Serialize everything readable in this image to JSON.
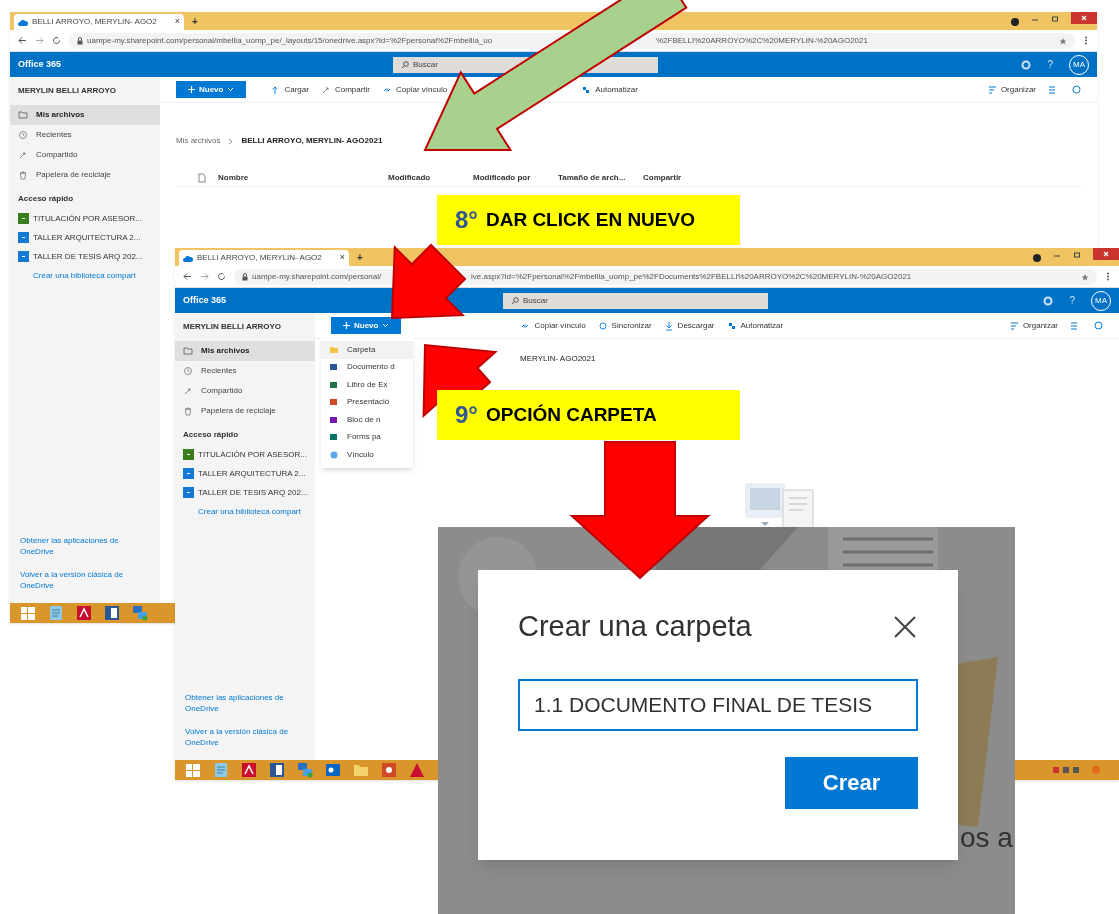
{
  "windows": [
    {
      "tab_title": "BELLI ARROYO, MERYLIN- AGO2",
      "tab_close": "×",
      "new_tab": "+",
      "url_start": "uampe-my.sharepoint.com/personal/mbellia_uomp_pe/_layouts/15/onedrive.aspx?id=%2Fpersonal%2Fmbellia_uo",
      "url_end": "%2FBELLI%20ARROYO%2C%20MERYLIN-%20AGO2021",
      "app_name": "Office 365",
      "search_placeholder": "Buscar",
      "help": "?",
      "avatar": "MA",
      "user_name": "MERYLIN BELLI ARROYO",
      "nav": [
        {
          "label": "Mis archivos",
          "kind": "folder",
          "selected": true
        },
        {
          "label": "Recientes",
          "kind": "clock",
          "selected": false
        },
        {
          "label": "Compartido",
          "kind": "share",
          "selected": false
        },
        {
          "label": "Papelera de reciclaje",
          "kind": "trash",
          "selected": false
        }
      ],
      "quick_heading": "Acceso rápido",
      "quick": [
        {
          "label": "TITULACIÓN POR ASESOR...",
          "color": "#3a7d1e"
        },
        {
          "label": "TALLER ARQUITECTURA 2...",
          "color": "#1479d4"
        },
        {
          "label": "TALLER DE TESIS ARQ 202...",
          "color": "#1479d4"
        }
      ],
      "create_library": "Crear una biblioteca compart",
      "footer_links": [
        "Obtener las aplicaciones de OneDrive",
        "Volver a la versión clásica de OneDrive"
      ],
      "new_button": "Nuevo",
      "toolbar_groups": [
        [
          {
            "label": "Cargar",
            "kind": "upload"
          },
          {
            "label": "Compartir",
            "kind": "share"
          },
          {
            "label": "Copiar vínculo",
            "kind": "link"
          }
        ],
        [
          {
            "label": "Automatizar",
            "kind": "automate"
          }
        ]
      ],
      "organize": "Organizar",
      "breadcrumb": [
        "Mis archivos",
        "BELLI ARROYO, MERYLIN- AGO2021"
      ],
      "columns": [
        "Nombre",
        "Modificado",
        "Modificado por",
        "Tamaño de arch...",
        "Compartir"
      ]
    },
    {
      "tab_title": "BELLI ARROYO, MERYLIN- AGO2",
      "tab_close": "×",
      "new_tab": "+",
      "url_start": "uampe-my.sharepoint.com/personal/",
      "url_end": "ive.aspx?id=%2Fpersonal%2Fmbellia_uomp_pe%2FDocuments%2FBELLI%20ARROYO%2C%20MERYLIN-%20AGO2021",
      "app_name": "Office 365",
      "search_placeholder": "Buscar",
      "help": "?",
      "avatar": "MA",
      "user_name": "MERYLIN BELLI ARROYO",
      "nav": [
        {
          "label": "Mis archivos",
          "kind": "folder",
          "selected": true
        },
        {
          "label": "Recientes",
          "kind": "clock",
          "selected": false
        },
        {
          "label": "Compartido",
          "kind": "share",
          "selected": false
        },
        {
          "label": "Papelera de reciclaje",
          "kind": "trash",
          "selected": false
        }
      ],
      "quick_heading": "Acceso rápido",
      "quick": [
        {
          "label": "TITULACIÓN POR ASESOR...",
          "color": "#3a7d1e"
        },
        {
          "label": "TALLER ARQUITECTURA 2...",
          "color": "#1479d4"
        },
        {
          "label": "TALLER DE TESIS ARQ 202...",
          "color": "#1479d4"
        }
      ],
      "create_library": "Crear una biblioteca compart",
      "footer_links": [
        "Obtener las aplicaciones de OneDrive",
        "Volver a la versión clásica de OneDrive"
      ],
      "new_button": "Nuevo",
      "toolbar_groups": [
        [
          {
            "label": "Copiar vínculo",
            "kind": "link"
          },
          {
            "label": "Sincronizar",
            "kind": "sync"
          },
          {
            "label": "Descargar",
            "kind": "download"
          },
          {
            "label": "Automatizar",
            "kind": "automate"
          }
        ]
      ],
      "organize": "Organizar",
      "breadcrumb_tail": "MERYLIN- AGO2021",
      "new_menu": [
        {
          "label": "Carpeta",
          "kind": "folder",
          "selected": true
        },
        {
          "label": "Documento d",
          "kind": "word",
          "selected": false
        },
        {
          "label": "Libro de Ex",
          "kind": "excel",
          "selected": false
        },
        {
          "label": "Presentació",
          "kind": "ppt",
          "selected": false
        },
        {
          "label": "Bloc de n",
          "kind": "onenote",
          "selected": false
        },
        {
          "label": "Forms pa",
          "kind": "forms",
          "selected": false
        },
        {
          "label": "Vínculo",
          "kind": "link",
          "selected": false
        }
      ]
    }
  ],
  "callouts": [
    {
      "number": "8°",
      "text": "DAR CLICK EN NUEVO"
    },
    {
      "number": "9°",
      "text": "OPCIÓN CARPETA"
    }
  ],
  "dialog": {
    "title": "Crear una carpeta",
    "value": "1.1 DOCUMENTO FINAL DE TESIS",
    "button": "Crear",
    "background_text": "os a"
  }
}
